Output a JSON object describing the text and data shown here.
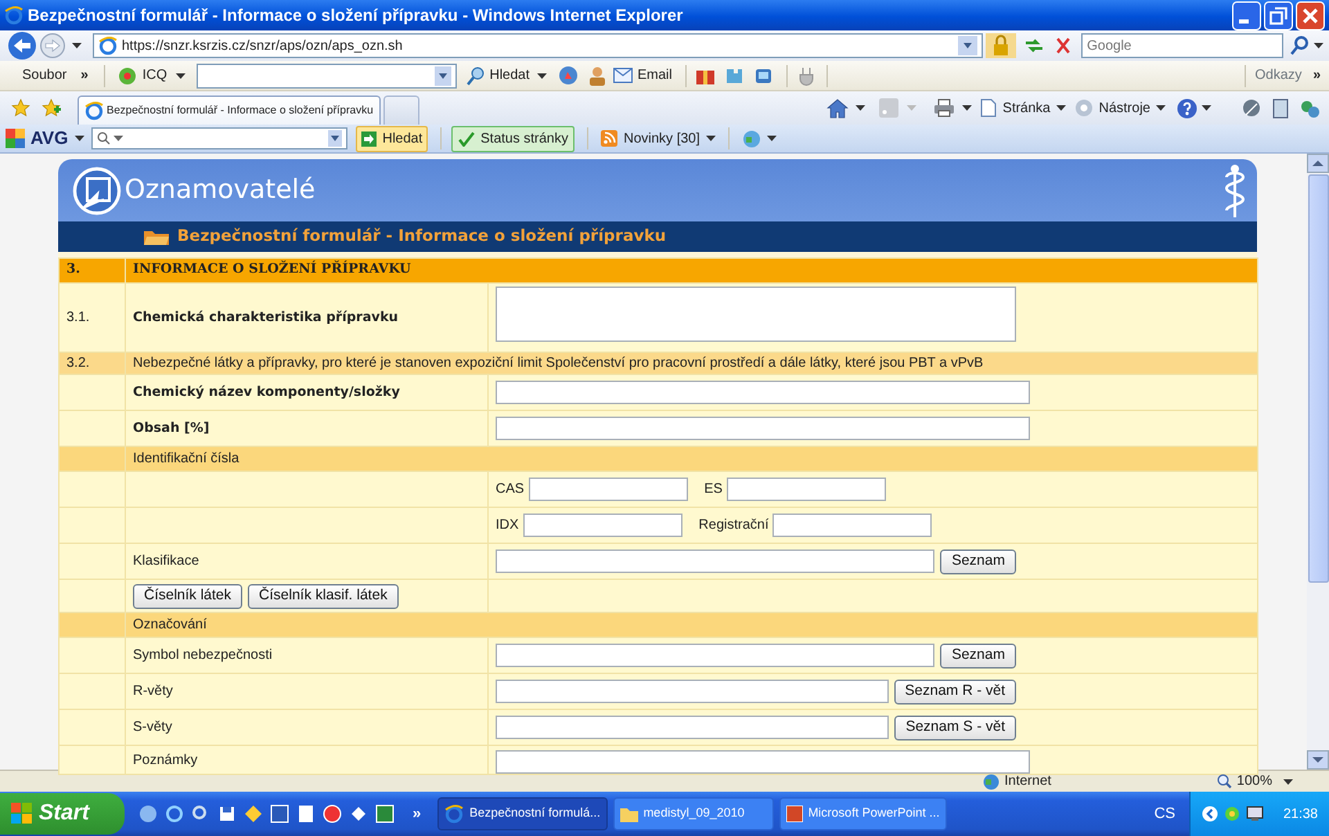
{
  "window": {
    "title": "Bezpečnostní formulář - Informace o složení přípravku - Windows Internet Explorer"
  },
  "address_bar": {
    "url": "https://snzr.ksrzis.cz/snzr/aps/ozn/aps_ozn.sh",
    "search_placeholder": "Google"
  },
  "toolbar": {
    "menu": "Soubor",
    "chevron": "»",
    "icq": "ICQ",
    "search_button": "Hledat",
    "email": "Email",
    "links": "Odkazy",
    "links_chevron": "»"
  },
  "tab": {
    "title": "Bezpečnostní formulář - Informace o složení přípravku"
  },
  "command_bar": {
    "page": "Stránka",
    "tools": "Nástroje"
  },
  "avg_bar": {
    "logo": "AVG",
    "search_button": "Hledat",
    "status_button": "Status stránky",
    "news_button": "Novinky [30]"
  },
  "page": {
    "app_title": "Oznamovatelé",
    "subtitle": "Bezpečnostní formulář - Informace o složení přípravku"
  },
  "form": [
    {
      "kind": "section",
      "number": "3.",
      "title": "INFORMACE O SLOŽENÍ PŘÍPRAVKU"
    },
    {
      "kind": "textarea",
      "number": "3.1.",
      "label": "Chemická charakteristika přípravku",
      "bold": true
    },
    {
      "kind": "note",
      "number": "3.2.",
      "text": "Nebezpečné látky a přípravky, pro které je stanoven expoziční limit Společenství pro pracovní prostředí a dále látky, které jsou PBT a vPvB"
    },
    {
      "kind": "field",
      "label": "Chemický název komponenty/složky",
      "bold": true
    },
    {
      "kind": "field",
      "label": "Obsah [%]",
      "bold": true
    },
    {
      "kind": "band",
      "text": "Identifikační čísla"
    },
    {
      "kind": "pair",
      "fields": [
        "CAS",
        "ES"
      ]
    },
    {
      "kind": "pair",
      "fields": [
        "IDX",
        "Registrační"
      ]
    },
    {
      "kind": "field",
      "label": "Klasifikace",
      "bold": false,
      "button": "Seznam"
    },
    {
      "kind": "buttons",
      "buttons": [
        "Číselník látek",
        "Číselník klasif. látek"
      ]
    },
    {
      "kind": "band",
      "text": "Označování"
    },
    {
      "kind": "field",
      "label": "Symbol nebezpečnosti",
      "bold": false,
      "button": "Seznam"
    },
    {
      "kind": "field",
      "label": "R-věty",
      "bold": false,
      "button": "Seznam R - vět"
    },
    {
      "kind": "field",
      "label": "S-věty",
      "bold": false,
      "button": "Seznam S - vět"
    },
    {
      "kind": "field",
      "label": "Poznámky",
      "bold": false
    }
  ],
  "status_bar": {
    "zone": "Internet",
    "zoom": "100%"
  },
  "taskbar": {
    "start": "Start",
    "chevron": "»",
    "tasks": [
      {
        "title": "Bezpečnostní formulá...",
        "selected": true
      },
      {
        "title": "medistyl_09_2010",
        "selected": false
      },
      {
        "title": "Microsoft PowerPoint ...",
        "selected": false
      }
    ],
    "language": "CS",
    "clock": "21:38"
  }
}
